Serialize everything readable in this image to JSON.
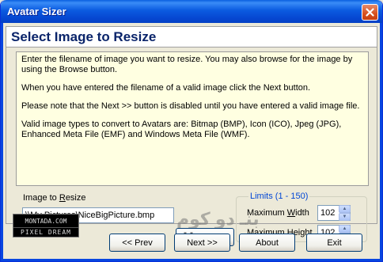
{
  "window": {
    "title": "Avatar Sizer"
  },
  "header": {
    "title": "Select Image to Resize"
  },
  "info": {
    "paragraphs": [
      "Enter the filename of image you want to resize. You may also browse for the image by using the Browse button.",
      "When you have entered the filename of a valid image click the Next button.",
      "Please note that the Next >> button is disabled until you have entered a valid image file.",
      "Valid image types to convert to Avatars are: Bitmap (BMP), Icon (ICO),  Jpeg (JPG), Enhanced Meta File (EMF) and Windows Meta File (WMF)."
    ]
  },
  "image": {
    "label": "Image to Resize",
    "path": "\\\\My Pictures\\NiceBigPicture.bmp",
    "browse_label": "Browse"
  },
  "limits": {
    "title": "Limits (1 - 150)",
    "width_label": "Maximum Width",
    "width_value": "102",
    "height_label": "Maximum Height",
    "height_value": "102"
  },
  "logo": {
    "line1": "MONTADA.COM",
    "line2": "PIXEL DREAM"
  },
  "buttons": {
    "prev": "<< Prev",
    "next": "Next >>",
    "about": "About",
    "exit": "Exit"
  },
  "icons": {
    "close": "close-icon",
    "browse": "binoculars-icon"
  }
}
